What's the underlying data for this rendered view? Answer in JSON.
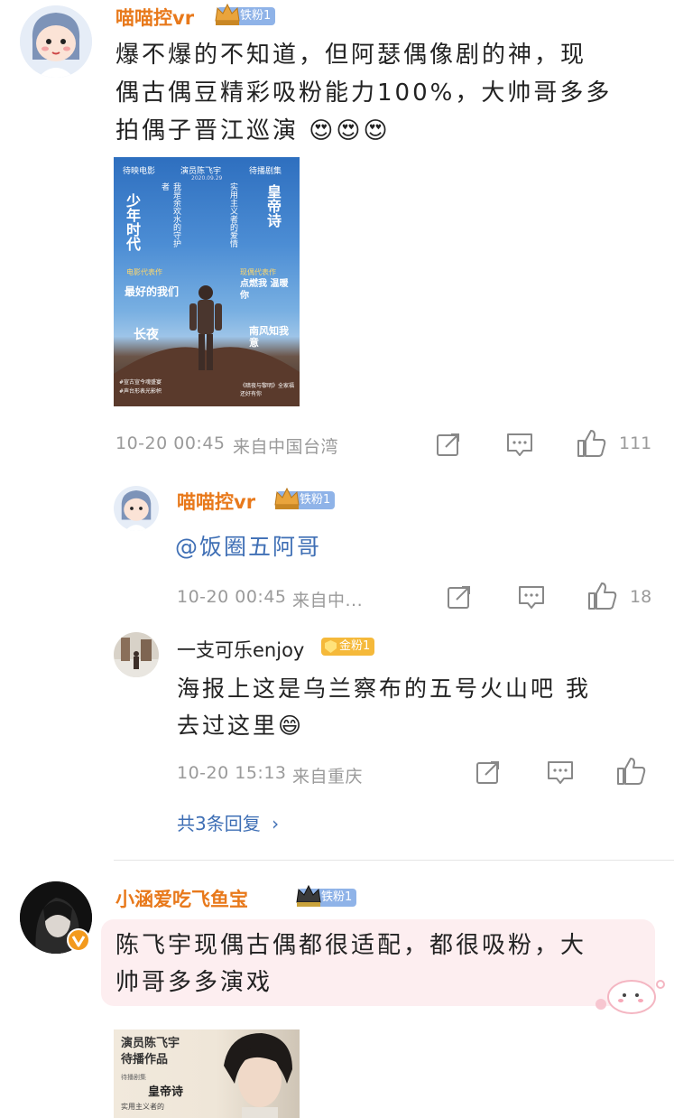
{
  "comments": [
    {
      "username": "喵喵控vr",
      "badge": "铁粉1",
      "text_lines": [
        "爆不爆的不知道，但阿瑟偶像剧的神，现",
        "偶古偶豆精彩吸粉能力100%，大帅哥多多",
        "拍偶子晋江巡演"
      ],
      "emojis": [
        "😍",
        "😍",
        "😍"
      ],
      "time": "10-20 00:45",
      "location": "来自中国台湾",
      "likes": "111",
      "poster": {
        "header_left": "待映电影",
        "header_center": "演员陈飞宇",
        "header_right": "待播剧集",
        "date": "2020.09.29",
        "title_left": "少年时代",
        "title_mid_left": "我是余欢水的守护者",
        "title_mid_right": "实用主义者的爱情",
        "title_right": "皇帝诗",
        "tag_left_1": "电影代表作",
        "tag_right_1": "现偶代表作",
        "work_left_1": "最好的我们",
        "work_right_1": "点燃我 温暖你",
        "work_left_2": "长夜",
        "work_right_2": "南风知我意",
        "foot_left_1": "#宣古宣今魂盛宴",
        "foot_left_2": "#声台形表光影帜",
        "foot_right": "《暗夜与黎明》全家福 还好有你"
      }
    }
  ],
  "replies": [
    {
      "username": "喵喵控vr",
      "badge": "铁粉1",
      "text": "@饭圈五阿哥",
      "time": "10-20 00:45",
      "location": "来自中...",
      "likes": "18"
    },
    {
      "username": "一支可乐enjoy",
      "badge": "金粉1",
      "text_lines": [
        "海报上这是乌兰察布的五号火山吧 我",
        "去过这里"
      ],
      "emoji": "😄",
      "time": "10-20 15:13",
      "location": "来自重庆"
    }
  ],
  "more_replies": "共3条回复",
  "comment2": {
    "username": "小涵爱吃飞鱼宝",
    "badge": "铁粉1",
    "text_lines": [
      "陈飞宇现偶古偶都很适配，都很吸粉，大",
      "帅哥多多演戏"
    ],
    "poster": {
      "line1": "演员陈飞宇",
      "line2": "待播作品",
      "line3": "待播剧集",
      "line4": "实用主义者的",
      "title": "皇帝诗"
    }
  },
  "colors": {
    "username": "#e8791b",
    "badge_iron": "#8fb3e8",
    "badge_gold": "#f5b93a",
    "meta": "#9a9a9a",
    "link": "#3f6fb5"
  },
  "icons": [
    "repost-icon",
    "comment-icon",
    "like-icon",
    "verified-icon",
    "crown-icon"
  ]
}
